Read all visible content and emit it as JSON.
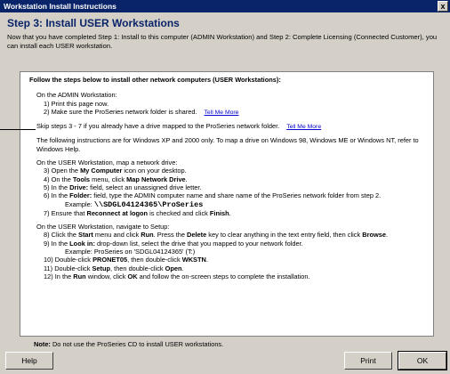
{
  "window": {
    "title": "Workstation Install Instructions",
    "close_glyph": "x"
  },
  "step_title": "Step 3: Install USER Workstations",
  "intro": "Now that you have completed Step 1: Install to this computer (ADMIN Workstation) and Step 2: Complete Licensing (Connected Customer), you can install each USER workstation.",
  "panel": {
    "heading": "Follow the steps below to install other network computers (USER Workstations):",
    "admin_header": "On the ADMIN Workstation:",
    "admin_steps": [
      {
        "n": "1)",
        "text": "Print this page now."
      },
      {
        "n": "2)",
        "text": "Make sure the ProSeries network folder is shared.",
        "link": "Tell Me More"
      }
    ],
    "skip_text": "Skip steps 3 - 7 if you already have a drive mapped to the ProSeries network folder.",
    "skip_link": "Tell Me More",
    "winxp_note": "The following instructions are for Windows XP and 2000 only. To map a drive on Windows 98, Windows ME or Windows NT, refer to Windows Help.",
    "map_header": "On the USER Workstation, map a network drive:",
    "map_steps": [
      {
        "n": "3)",
        "pre": "Open the ",
        "bold": "My Computer",
        "post": " icon on your desktop."
      },
      {
        "n": "4)",
        "pre": "On the ",
        "bold": "Tools",
        "mid": " menu, click ",
        "bold2": "Map Network Drive",
        "post": "."
      },
      {
        "n": "5)",
        "pre": "In the ",
        "bold": "Drive:",
        "post": " field, select an unassigned drive letter."
      },
      {
        "n": "6)",
        "pre": "In the ",
        "bold": "Folder:",
        "post": " field, type the ADMIN computer name and share name of the ProSeries network folder from step 2."
      }
    ],
    "example_label": "Example:",
    "example_path": "\\\\SDGL04124365\\ProSeries",
    "step7": {
      "n": "7)",
      "pre": "Ensure that ",
      "bold": "Reconnect at logon",
      "mid": " is checked and click ",
      "bold2": "Finish",
      "post": "."
    },
    "setup_header": "On the USER Workstation, navigate to Setup:",
    "setup_steps": [
      {
        "n": "8)",
        "pre": "Click the ",
        "bold": "Start",
        "mid": " menu and click ",
        "bold2": "Run",
        "mid2": ". Press the ",
        "bold3": "Delete",
        "mid3": " key to clear anything in the text entry field, then click ",
        "bold4": "Browse",
        "post": "."
      },
      {
        "n": "9)",
        "pre": "In the ",
        "bold": "Look in:",
        "post": " drop-down list, select the drive that you mapped to your network folder."
      }
    ],
    "step9_example": "Example: ProSeries on 'SDGL04124365' (T:)",
    "setup_steps2": [
      {
        "n": "10)",
        "pre": "Double-click ",
        "bold": "PRONET05",
        "mid": ", then double-click ",
        "bold2": "WKSTN",
        "post": "."
      },
      {
        "n": "11)",
        "pre": "Double-click ",
        "bold": "Setup",
        "mid": ", then double-click ",
        "bold2": "Open",
        "post": "."
      },
      {
        "n": "12)",
        "pre": "In the ",
        "bold": "Run",
        "mid": " window, click ",
        "bold2": "OK",
        "post": " and follow the on-screen steps to complete the installation."
      }
    ]
  },
  "note_label": "Note:",
  "note_text": " Do not use the ProSeries CD to install USER workstations.",
  "buttons": {
    "help": "Help",
    "print": "Print",
    "ok": "OK"
  }
}
